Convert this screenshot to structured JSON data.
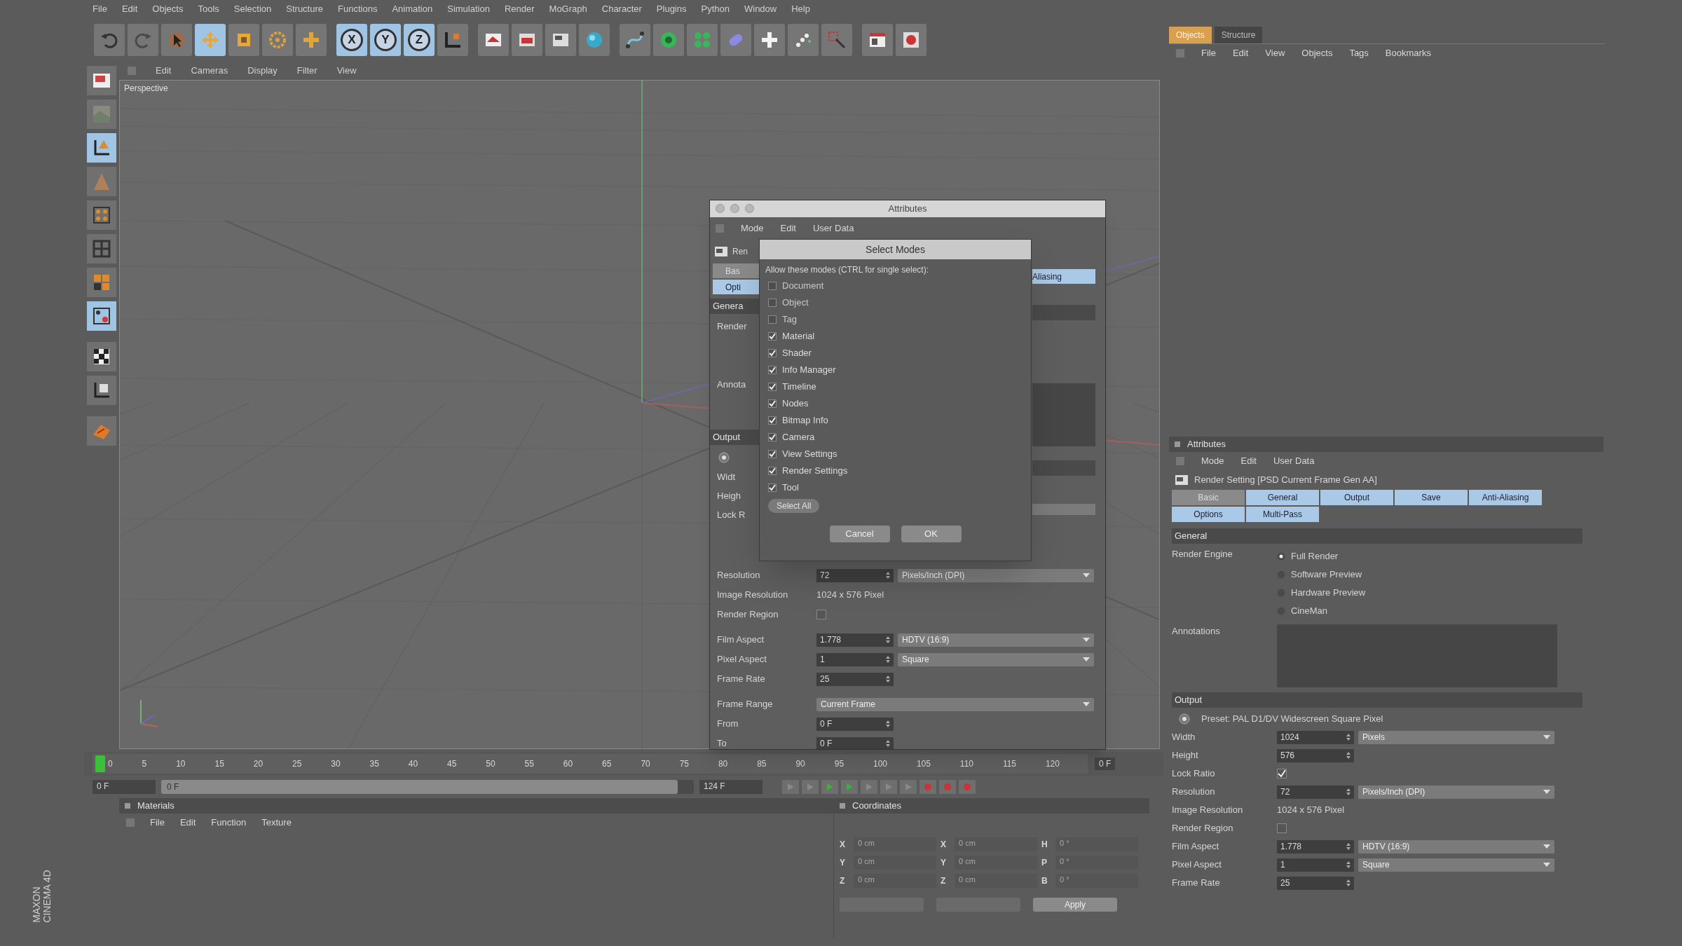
{
  "menu_bar": [
    "File",
    "Edit",
    "Objects",
    "Tools",
    "Selection",
    "Structure",
    "Functions",
    "Animation",
    "Simulation",
    "Render",
    "MoGraph",
    "Character",
    "Plugins",
    "Python",
    "Window",
    "Help"
  ],
  "toolbar": [
    {
      "kind": "icon",
      "active": false
    },
    {
      "kind": "icon",
      "active": false
    },
    {
      "kind": "icon",
      "active": false
    },
    {
      "kind": "icon",
      "active": true
    },
    {
      "kind": "icon",
      "active": false
    },
    {
      "kind": "icon",
      "active": false
    },
    {
      "kind": "icon",
      "active": false
    },
    {
      "kind": "axis",
      "label": "X",
      "active": true
    },
    {
      "kind": "axis",
      "label": "Y",
      "active": true
    },
    {
      "kind": "axis",
      "label": "Z",
      "active": true
    },
    {
      "kind": "icon",
      "active": false
    },
    {
      "kind": "icon",
      "active": false
    },
    {
      "kind": "icon",
      "active": false
    },
    {
      "kind": "icon",
      "active": false
    },
    {
      "kind": "icon",
      "active": false
    },
    {
      "kind": "icon",
      "active": false
    },
    {
      "kind": "icon",
      "active": false
    },
    {
      "kind": "icon",
      "active": false
    },
    {
      "kind": "icon",
      "active": false
    },
    {
      "kind": "icon",
      "active": false
    },
    {
      "kind": "icon",
      "active": false
    },
    {
      "kind": "icon",
      "active": false
    },
    {
      "kind": "icon",
      "active": false
    },
    {
      "kind": "icon",
      "active": false
    }
  ],
  "left_tools": [
    {
      "active": false
    },
    {
      "active": false
    },
    {
      "active": true
    },
    {
      "active": false
    },
    {
      "active": false
    },
    {
      "active": false
    },
    {
      "active": false
    },
    {
      "active": true
    },
    {
      "active": false
    },
    {
      "active": false
    },
    {
      "active": false
    }
  ],
  "viewport": {
    "menu": [
      "Edit",
      "Cameras",
      "Display",
      "Filter",
      "View"
    ],
    "label": "Perspective"
  },
  "timeline": {
    "ticks": [
      "0",
      "5",
      "10",
      "15",
      "20",
      "25",
      "30",
      "35",
      "40",
      "45",
      "50",
      "55",
      "60",
      "65",
      "70",
      "75",
      "80",
      "85",
      "90",
      "95",
      "100",
      "105",
      "110",
      "115",
      "120"
    ],
    "frame_field": "0 F",
    "start_field": "0 F",
    "range": {
      "label": "0 F",
      "level": 0.97
    },
    "end_field": "124 F"
  },
  "materials": {
    "title": "Materials",
    "menu": [
      "File",
      "Edit",
      "Function",
      "Texture"
    ]
  },
  "coordinates": {
    "title": "Coordinates",
    "rows": [
      [
        "X",
        "0 cm",
        "X",
        "0 cm",
        "H",
        "0 °"
      ],
      [
        "Y",
        "0 cm",
        "Y",
        "0 cm",
        "P",
        "0 °"
      ],
      [
        "Z",
        "0 cm",
        "Z",
        "0 cm",
        "B",
        "0 °"
      ]
    ],
    "apply": "Apply"
  },
  "brand": [
    "MAXON",
    "CINEMA 4D"
  ],
  "object_manager": {
    "tabs": [
      {
        "label": "Objects",
        "selected": true
      },
      {
        "label": "Structure",
        "selected": false
      }
    ],
    "menu": [
      "File",
      "Edit",
      "View",
      "Objects",
      "Tags",
      "Bookmarks"
    ]
  },
  "attributes_panel": {
    "title": "Attributes",
    "menu": [
      "Mode",
      "Edit",
      "User Data"
    ],
    "heading": "Render Setting [PSD Current Frame Gen AA]",
    "tabs": [
      [
        {
          "label": "Basic",
          "selected": false
        },
        {
          "label": "General",
          "selected": true
        },
        {
          "label": "Output",
          "selected": true
        },
        {
          "label": "Save",
          "selected": true
        },
        {
          "label": "Anti-Aliasing",
          "selected": true
        }
      ],
      [
        {
          "label": "Options",
          "selected": true
        },
        {
          "label": "Multi-Pass",
          "selected": true
        }
      ]
    ],
    "rows": [
      {
        "kind": "section",
        "label": "General"
      },
      {
        "kind": "radio",
        "label": "Render Engine",
        "options": [
          {
            "label": "Full Render",
            "selected": true
          },
          {
            "label": "Software Preview",
            "selected": false
          },
          {
            "label": "Hardware Preview",
            "selected": false
          },
          {
            "label": "CineMan",
            "selected": false
          }
        ]
      },
      {
        "kind": "textarea",
        "label": "Annotations"
      },
      {
        "kind": "section",
        "label": "Output"
      },
      {
        "kind": "preset",
        "label": "Preset: PAL D1/DV Widescreen Square Pixel"
      },
      {
        "kind": "field",
        "label": "Width",
        "value": "1024",
        "unit": "Pixels"
      },
      {
        "kind": "field",
        "label": "Height",
        "value": "576"
      },
      {
        "kind": "check",
        "label": "Lock Ratio",
        "checked": true
      },
      {
        "kind": "field",
        "label": "Resolution",
        "value": "72",
        "unit": "Pixels/Inch (DPI)"
      },
      {
        "kind": "text",
        "label": "Image Resolution",
        "value": "1024 x 576 Pixel"
      },
      {
        "kind": "check",
        "label": "Render Region",
        "checked": false
      },
      {
        "kind": "field",
        "label": "Film Aspect",
        "value": "1.778",
        "unit": "HDTV (16:9)"
      },
      {
        "kind": "field",
        "label": "Pixel Aspect",
        "value": "1",
        "unit": "Square"
      },
      {
        "kind": "field",
        "label": "Frame Rate",
        "value": "25"
      }
    ]
  },
  "attributes_dialog": {
    "title": "Attributes",
    "menu": [
      "Mode",
      "Edit",
      "User Data"
    ],
    "left_fragments": [
      {
        "kind": "header",
        "label": "Ren"
      },
      {
        "kind": "tab",
        "label": "Bas",
        "selected": false
      },
      {
        "kind": "tab",
        "label": "Opti",
        "selected": true
      },
      {
        "kind": "section",
        "label": "Genera"
      },
      {
        "kind": "label",
        "label": "Render"
      },
      {
        "kind": "textarea",
        "label": "Annota"
      },
      {
        "kind": "section",
        "label": "Output"
      },
      {
        "kind": "preset"
      },
      {
        "kind": "label",
        "label": "Widt"
      },
      {
        "kind": "label",
        "label": "Heigh"
      },
      {
        "kind": "label",
        "label": "Lock R"
      }
    ],
    "right_tab": {
      "label": "Aliasing",
      "selected": true
    },
    "rows": [
      {
        "kind": "field",
        "label": "Resolution",
        "value": "72",
        "unit": "Pixels/Inch (DPI)"
      },
      {
        "kind": "text",
        "label": "Image Resolution",
        "value": "1024 x 576 Pixel"
      },
      {
        "kind": "check",
        "label": "Render Region",
        "checked": false
      },
      {
        "kind": "field",
        "label": "Film Aspect",
        "value": "1.778",
        "unit": "HDTV (16:9)"
      },
      {
        "kind": "field",
        "label": "Pixel Aspect",
        "value": "1",
        "unit": "Square"
      },
      {
        "kind": "field",
        "label": "Frame Rate",
        "value": "25"
      },
      {
        "kind": "dropdown",
        "label": "Frame Range",
        "value": "Current Frame"
      },
      {
        "kind": "field",
        "label": "From",
        "value": "0 F"
      },
      {
        "kind": "field",
        "label": "To",
        "value": "0 F"
      }
    ]
  },
  "select_modes": {
    "title": "Select Modes",
    "hint": "Allow these modes (CTRL for single select):",
    "modes": [
      {
        "label": "Document",
        "checked": false
      },
      {
        "label": "Object",
        "checked": false
      },
      {
        "label": "Tag",
        "checked": false
      },
      {
        "label": "Material",
        "checked": true
      },
      {
        "label": "Shader",
        "checked": true
      },
      {
        "label": "Info Manager",
        "checked": true
      },
      {
        "label": "Timeline",
        "checked": true
      },
      {
        "label": "Nodes",
        "checked": true
      },
      {
        "label": "Bitmap Info",
        "checked": true
      },
      {
        "label": "Camera",
        "checked": true
      },
      {
        "label": "View Settings",
        "checked": true
      },
      {
        "label": "Render Settings",
        "checked": true
      },
      {
        "label": "Tool",
        "checked": true
      }
    ],
    "select_all": "Select All",
    "cancel": "Cancel",
    "ok": "OK"
  }
}
